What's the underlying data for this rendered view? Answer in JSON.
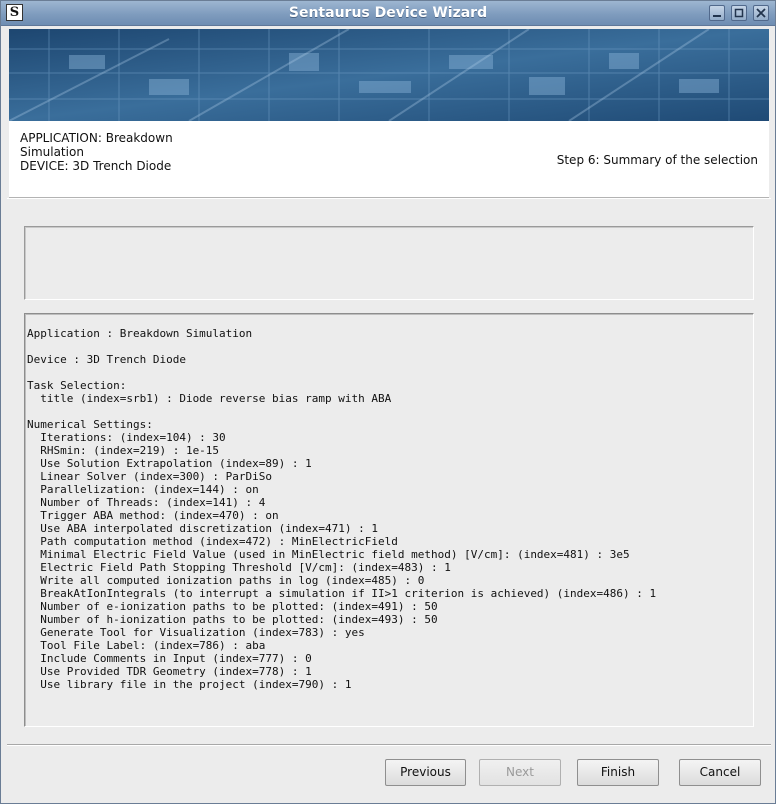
{
  "window": {
    "title": "Sentaurus Device Wizard",
    "icon_letter": "S",
    "controls": [
      "minimize-icon",
      "maximize-icon",
      "close-icon"
    ]
  },
  "header": {
    "application_line1": "APPLICATION: Breakdown",
    "application_line2": "Simulation",
    "device_line": "DEVICE: 3D Trench Diode",
    "step_label": "Step 6: Summary of the selection"
  },
  "description_box": {
    "text": ""
  },
  "summary": {
    "lines": [
      "Application : Breakdown Simulation",
      "",
      "Device : 3D Trench Diode",
      "",
      "Task Selection:",
      "  title (index=srb1) : Diode reverse bias ramp with ABA",
      "",
      "Numerical Settings:",
      "  Iterations: (index=104) : 30",
      "  RHSmin: (index=219) : 1e-15",
      "  Use Solution Extrapolation (index=89) : 1",
      "  Linear Solver (index=300) : ParDiSo",
      "  Parallelization: (index=144) : on",
      "  Number of Threads: (index=141) : 4",
      "  Trigger ABA method: (index=470) : on",
      "  Use ABA interpolated discretization (index=471) : 1",
      "  Path computation method (index=472) : MinElectricField",
      "  Minimal Electric Field Value (used in MinElectric field method) [V/cm]: (index=481) : 3e5",
      "  Electric Field Path Stopping Threshold [V/cm]: (index=483) : 1",
      "  Write all computed ionization paths in log (index=485) : 0",
      "  BreakAtIonIntegrals (to interrupt a simulation if II>1 criterion is achieved) (index=486) : 1",
      "  Number of e-ionization paths to be plotted: (index=491) : 50",
      "  Number of h-ionization paths to be plotted: (index=493) : 50",
      "  Generate Tool for Visualization (index=783) : yes",
      "  Tool File Label: (index=786) : aba",
      "  Include Comments in Input (index=777) : 0",
      "  Use Provided TDR Geometry (index=778) : 1",
      "  Use library file in the project (index=790) : 1"
    ]
  },
  "buttons": {
    "previous": "Previous",
    "next": "Next",
    "finish": "Finish",
    "cancel": "Cancel"
  },
  "colors": {
    "titlebar": "#7f9cbe",
    "banner": "#27507a",
    "window_bg": "#ececec"
  }
}
